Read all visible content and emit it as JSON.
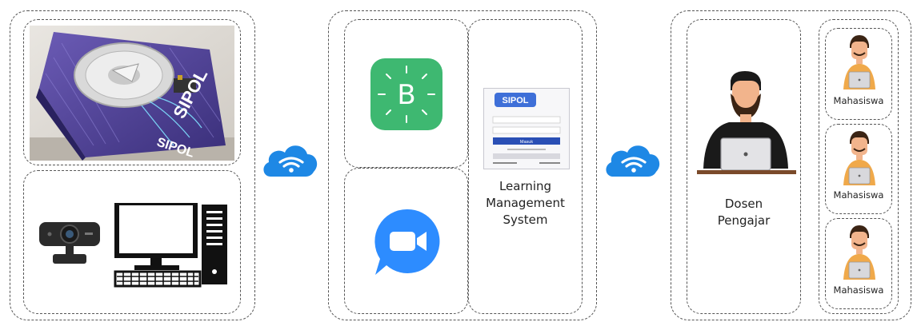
{
  "diagram": {
    "device_photo": {
      "brand_text": "SIPOL"
    },
    "lms_screenshot": {
      "logo_text": "SIPOL",
      "login_button_label": "Masuk"
    },
    "labels": {
      "lms": "Learning Management System",
      "lms_lines": [
        "Learning",
        "Management",
        "System"
      ],
      "lecturer": "Dosen Pengajar",
      "lecturer_lines": [
        "Dosen",
        "Pengajar"
      ],
      "students": [
        "Mahasiswa",
        "Mahasiswa",
        "Mahasiswa"
      ]
    },
    "colors": {
      "cloud_blue": "#1E88E5",
      "blynk_green": "#3EB871",
      "zoom_blue": "#2D8CFF",
      "photo_purple": "#4C3F91",
      "skin": "#F2B48C",
      "beard": "#3B2414",
      "shirt_black": "#1a1a1a",
      "student_shirt": "#F0A94A"
    },
    "icons": [
      "photo",
      "webcam-icon",
      "desktop-computer-icon",
      "cloud-wifi-icon",
      "blynk-icon",
      "video-call-icon",
      "lecturer-laptop-icon",
      "student-laptop-icon"
    ]
  }
}
